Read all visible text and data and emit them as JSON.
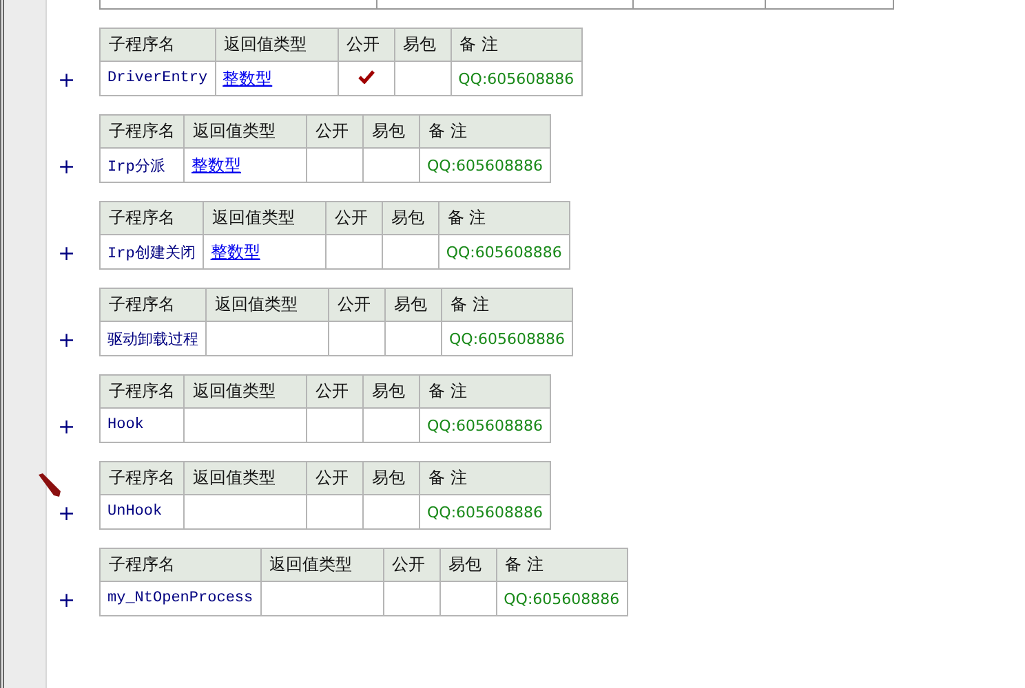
{
  "tables": [
    {
      "editing": false,
      "expand": "+",
      "headers": [
        "子程序名",
        "返回值类型",
        "公开",
        "易包",
        "备 注"
      ],
      "row": {
        "name": "DriverEntry",
        "return_type": "整数型",
        "public": true,
        "easy_pack": false,
        "remark": "QQ:605608886"
      }
    },
    {
      "editing": false,
      "expand": "+",
      "headers": [
        "子程序名",
        "返回值类型",
        "公开",
        "易包",
        "备 注"
      ],
      "row": {
        "name": "Irp分派",
        "return_type": "整数型",
        "public": false,
        "easy_pack": false,
        "remark": "QQ:605608886"
      }
    },
    {
      "editing": false,
      "expand": "+",
      "headers": [
        "子程序名",
        "返回值类型",
        "公开",
        "易包",
        "备 注"
      ],
      "row": {
        "name": "Irp创建关闭",
        "return_type": "整数型",
        "public": false,
        "easy_pack": false,
        "remark": "QQ:605608886"
      }
    },
    {
      "editing": false,
      "expand": "+",
      "headers": [
        "子程序名",
        "返回值类型",
        "公开",
        "易包",
        "备 注"
      ],
      "row": {
        "name": "驱动卸载过程",
        "public": false,
        "easy_pack": false,
        "remark": "QQ:605608886"
      }
    },
    {
      "editing": false,
      "expand": "+",
      "headers": [
        "子程序名",
        "返回值类型",
        "公开",
        "易包",
        "备 注"
      ],
      "row": {
        "name": "Hook",
        "public": false,
        "easy_pack": false,
        "remark": "QQ:605608886"
      }
    },
    {
      "editing": true,
      "expand": "+",
      "headers": [
        "子程序名",
        "返回值类型",
        "公开",
        "易包",
        "备 注"
      ],
      "row": {
        "name": "UnHook",
        "public": false,
        "easy_pack": false,
        "remark": "QQ:605608886"
      }
    },
    {
      "editing": false,
      "expand": "+",
      "headers": [
        "子程序名",
        "返回值类型",
        "公开",
        "易包",
        "备 注"
      ],
      "row": {
        "name": "my_NtOpenProcess",
        "public": false,
        "easy_pack": false,
        "remark": "QQ:605608886"
      }
    }
  ]
}
